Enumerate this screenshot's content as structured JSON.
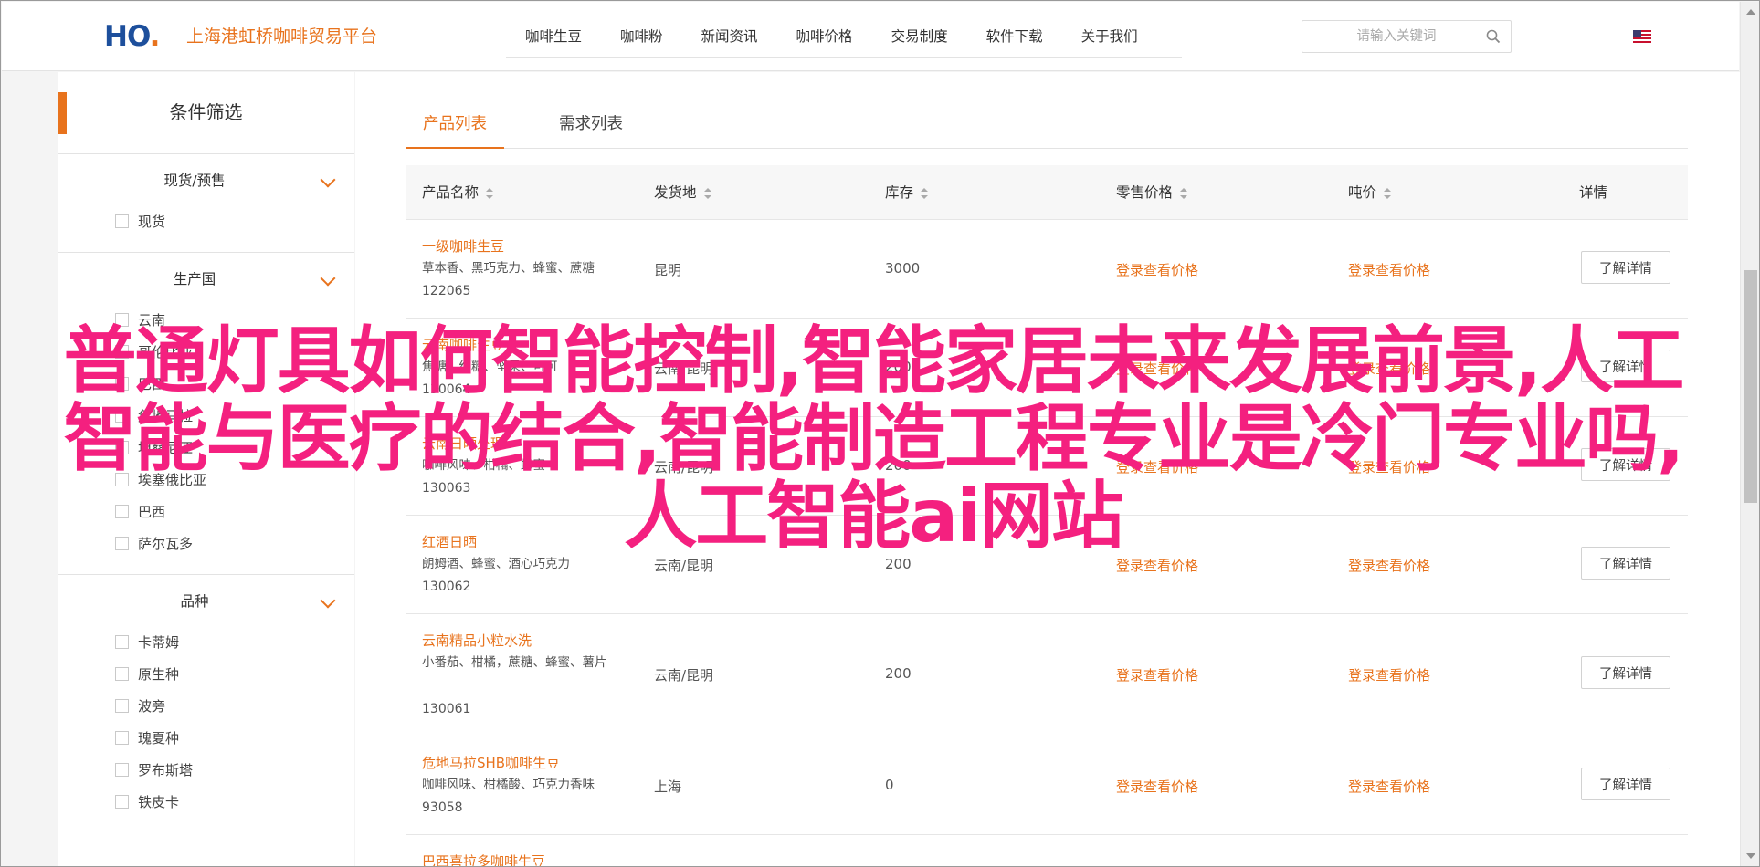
{
  "header": {
    "logo_mark": "H",
    "logo_mark_o": "O",
    "logo_mark_dot": ".",
    "logo_text": "上海港虹桥咖啡贸易平台",
    "nav": [
      "咖啡生豆",
      "咖啡粉",
      "新闻资讯",
      "咖啡价格",
      "交易制度",
      "软件下载",
      "关于我们"
    ],
    "search_placeholder": "请输入关键词",
    "search_icon": "search-icon",
    "language_flag": "us-flag-icon"
  },
  "sidebar": {
    "title": "条件筛选",
    "groups": [
      {
        "title": "现货/预售",
        "options": [
          "现货"
        ]
      },
      {
        "title": "生产国",
        "options": [
          "云南",
          "哥伦比亚",
          "巴西",
          "危地马拉",
          "坦桑尼亚",
          "埃塞俄比亚",
          "巴西",
          "萨尔瓦多"
        ]
      },
      {
        "title": "品种",
        "options": [
          "卡蒂姆",
          "原生种",
          "波旁",
          "瑰夏种",
          "罗布斯塔",
          "铁皮卡"
        ]
      }
    ]
  },
  "main": {
    "tabs": [
      "产品列表",
      "需求列表"
    ],
    "columns": [
      "产品名称",
      "发货地",
      "库存",
      "零售价格",
      "吨价",
      "详情"
    ],
    "rows": [
      {
        "name": "一级咖啡生豆",
        "desc": "草本香、黑巧克力、蜂蜜、蔗糖",
        "code": "122065",
        "origin": "昆明",
        "stock": "3000",
        "retail": "登录查看价格",
        "ton": "登录查看价格",
        "detail": "了解详情"
      },
      {
        "name": "云南咖啡生豆",
        "desc": "焦糖、红糖、坚果、可可",
        "code": "130064",
        "origin": "云南/昆明",
        "stock": "200",
        "retail": "登录查看价格",
        "ton": "登录查看价格",
        "detail": "了解详情"
      },
      {
        "name": "云南日晒处理",
        "desc": "咖啡风味、柑橘、蜂蜜",
        "code": "130063",
        "origin": "云南/昆明",
        "stock": "200",
        "retail": "登录查看价格",
        "ton": "登录查看价格",
        "detail": "了解详情"
      },
      {
        "name": "红酒日晒",
        "desc": "朗姆酒、蜂蜜、酒心巧克力",
        "code": "130062",
        "origin": "云南/昆明",
        "stock": "200",
        "retail": "登录查看价格",
        "ton": "登录查看价格",
        "detail": "了解详情"
      },
      {
        "name": "云南精品小粒水洗",
        "desc": "小番茄、柑橘，蔗糖、蜂蜜、薯片",
        "code": "130061",
        "origin": "云南/昆明",
        "stock": "200",
        "retail": "登录查看价格",
        "ton": "登录查看价格",
        "detail": "了解详情"
      },
      {
        "name": "危地马拉SHB咖啡生豆",
        "desc": "咖啡风味、柑橘酸、巧克力香味",
        "code": "93058",
        "origin": "上海",
        "stock": "0",
        "retail": "登录查看价格",
        "ton": "登录查看价格",
        "detail": "了解详情"
      },
      {
        "name": "巴西喜拉多咖啡生豆",
        "desc": "",
        "code": "",
        "origin": "",
        "stock": "",
        "retail": "",
        "ton": "",
        "detail": ""
      }
    ]
  },
  "overlay_text": "普通灯具如何智能控制,智能家居未来发展前景,人工智能与医疗的结合,智能制造工程专业是冷门专业吗,人工智能ai网站",
  "colors": {
    "accent": "#e8731d",
    "brand_blue": "#1d4f9c",
    "overlay_pink": "#f4207f"
  }
}
